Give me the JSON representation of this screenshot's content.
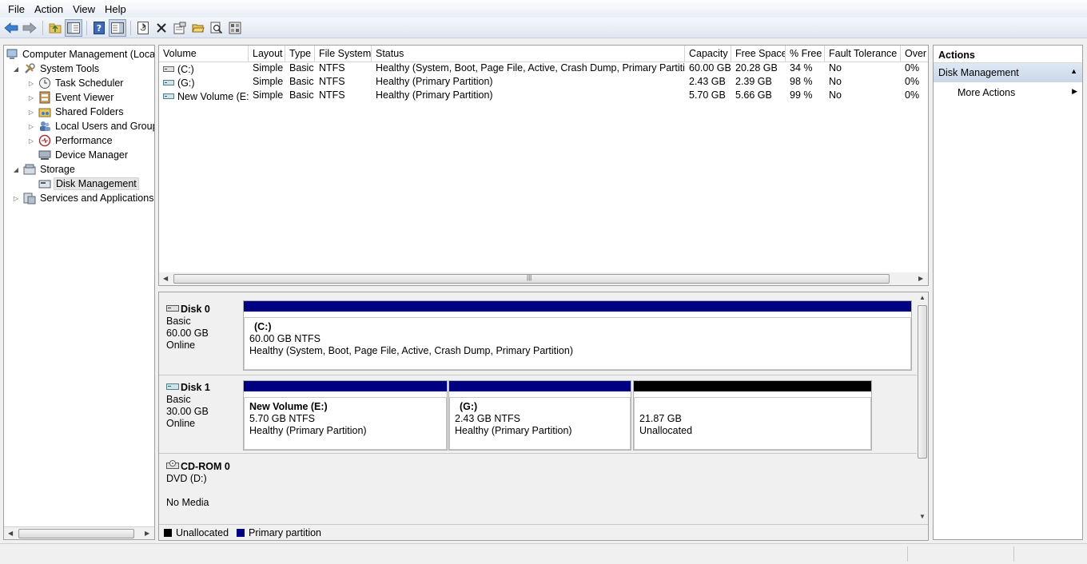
{
  "menu": [
    "File",
    "Action",
    "View",
    "Help"
  ],
  "tree": {
    "root": "Computer Management (Local",
    "system_tools": "System Tools",
    "task_scheduler": "Task Scheduler",
    "event_viewer": "Event Viewer",
    "shared_folders": "Shared Folders",
    "local_users": "Local Users and Groups",
    "performance": "Performance",
    "device_manager": "Device Manager",
    "storage": "Storage",
    "disk_management": "Disk Management",
    "services": "Services and Applications"
  },
  "volume_list": {
    "headers": [
      "Volume",
      "Layout",
      "Type",
      "File System",
      "Status",
      "Capacity",
      "Free Space",
      "% Free",
      "Fault Tolerance",
      "Over"
    ],
    "rows": [
      [
        "(C:)",
        "Simple",
        "Basic",
        "NTFS",
        "Healthy (System, Boot, Page File, Active, Crash Dump, Primary Partition)",
        "60.00 GB",
        "20.28 GB",
        "34 %",
        "No",
        "0%"
      ],
      [
        "(G:)",
        "Simple",
        "Basic",
        "NTFS",
        "Healthy (Primary Partition)",
        "2.43 GB",
        "2.39 GB",
        "98 %",
        "No",
        "0%"
      ],
      [
        "New Volume (E:)",
        "Simple",
        "Basic",
        "NTFS",
        "Healthy (Primary Partition)",
        "5.70 GB",
        "5.66 GB",
        "99 %",
        "No",
        "0%"
      ]
    ]
  },
  "disks": {
    "disk0": {
      "name": "Disk 0",
      "type": "Basic",
      "size": "60.00 GB",
      "status": "Online",
      "partitions": [
        {
          "title": "(C:)",
          "size": "60.00 GB NTFS",
          "status": "Healthy (System, Boot, Page File, Active, Crash Dump, Primary Partition)"
        }
      ]
    },
    "disk1": {
      "name": "Disk 1",
      "type": "Basic",
      "size": "30.00 GB",
      "status": "Online",
      "partitions": [
        {
          "title": "New Volume  (E:)",
          "size": "5.70 GB NTFS",
          "status": "Healthy (Primary Partition)"
        },
        {
          "title": "(G:)",
          "size": "2.43 GB NTFS",
          "status": "Healthy (Primary Partition)"
        },
        {
          "title": "",
          "size": "21.87 GB",
          "status": "Unallocated"
        }
      ]
    },
    "cdrom0": {
      "name": "CD-ROM 0",
      "type": "DVD (D:)",
      "status": "No Media"
    }
  },
  "legend": {
    "unallocated": "Unallocated",
    "primary": "Primary partition",
    "colors": {
      "unallocated": "#000000",
      "primary": "#000080"
    }
  },
  "actions": {
    "title": "Actions",
    "section": "Disk Management",
    "more": "More Actions"
  }
}
